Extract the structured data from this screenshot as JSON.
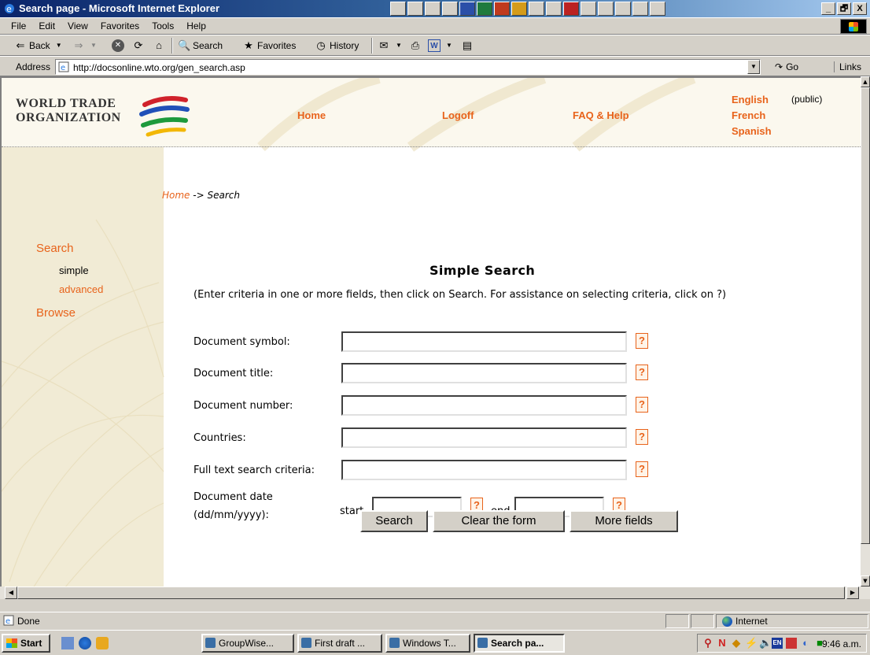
{
  "window": {
    "title": "Search page - Microsoft Internet Explorer",
    "buttons": [
      "_",
      "🗗",
      "X"
    ]
  },
  "menu": [
    "File",
    "Edit",
    "View",
    "Favorites",
    "Tools",
    "Help"
  ],
  "toolbar": {
    "back": "Back",
    "search": "Search",
    "favorites": "Favorites",
    "history": "History"
  },
  "address": {
    "label": "Address",
    "url": "http://docsonline.wto.org/gen_search.asp",
    "go": "Go",
    "links": "Links"
  },
  "header": {
    "logo_line1": "WORLD TRADE",
    "logo_line2": "ORGANIZATION",
    "nav": [
      "Home",
      "Logoff",
      "FAQ & Help"
    ],
    "languages": [
      "English",
      "French",
      "Spanish"
    ],
    "access_level": "(public)"
  },
  "breadcrumb": {
    "home": "Home",
    "arrow": "->",
    "current": "Search"
  },
  "sidebar": {
    "search": "Search",
    "simple": "simple",
    "advanced": "advanced",
    "browse": "Browse"
  },
  "form": {
    "title": "Simple Search",
    "instructions": "(Enter criteria in one or more fields, then click on Search. For assistance on selecting criteria, click on ?)",
    "fields": [
      {
        "label": "Document symbol:",
        "value": ""
      },
      {
        "label": "Document title:",
        "value": ""
      },
      {
        "label": "Document number:",
        "value": ""
      },
      {
        "label": "Countries:",
        "value": ""
      },
      {
        "label": "Full text search criteria:",
        "value": ""
      }
    ],
    "date_label_1": "Document date",
    "date_label_2": "(dd/mm/yyyy):",
    "start_label": "start",
    "end_label": "end",
    "help_glyph": "?",
    "buttons": {
      "search": "Search",
      "clear": "Clear the form",
      "more": "More fields"
    }
  },
  "status": {
    "text": "Done",
    "zone": "Internet"
  },
  "taskbar": {
    "start": "Start",
    "tasks": [
      "GroupWise...",
      "First draft ...",
      "Windows T...",
      "Search pa..."
    ],
    "clock": "9:46 a.m."
  },
  "colors": {
    "accent_orange": "#e8631b",
    "sidebar_bg": "#f1ebd5",
    "titlebar": "#0a246a"
  }
}
